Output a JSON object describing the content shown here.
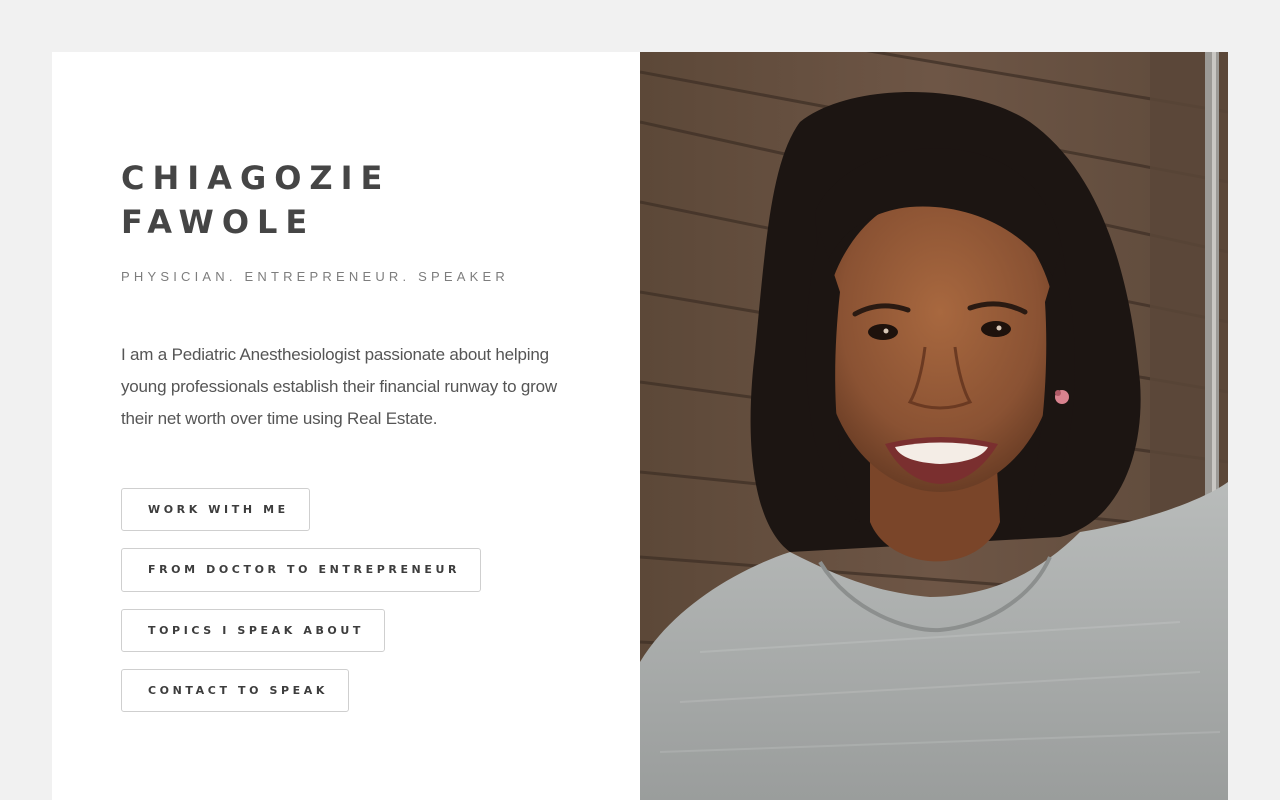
{
  "profile": {
    "name": "CHIAGOZIE FAWOLE",
    "tagline": "PHYSICIAN. ENTREPRENEUR. SPEAKER",
    "bio": "I am a Pediatric Anesthesiologist passionate about helping young professionals establish their financial runway to grow their net worth over time using Real Estate."
  },
  "buttons": [
    {
      "label": "WORK WITH ME"
    },
    {
      "label": "FROM DOCTOR TO ENTREPRENEUR"
    },
    {
      "label": "TOPICS I SPEAK ABOUT"
    },
    {
      "label": "CONTACT TO SPEAK"
    }
  ],
  "colors": {
    "page_background": "#f1f1f1",
    "card_background": "#ffffff",
    "heading_text": "#454545",
    "button_border": "#cfcfcf",
    "siding": "#6b5444",
    "top_color": "#a5a7a6",
    "hair": "#1c1512",
    "skin": "#8a5435"
  }
}
